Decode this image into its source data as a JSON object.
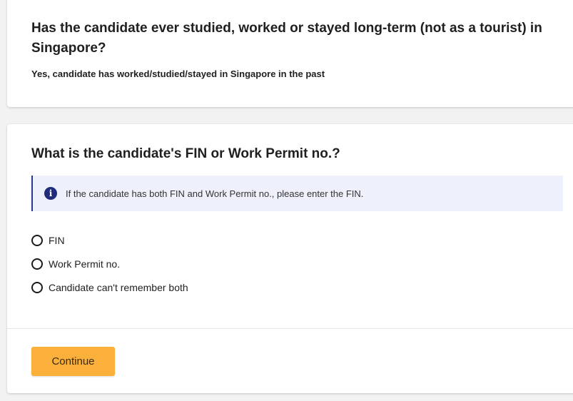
{
  "previous_question": {
    "title": "Has the candidate ever studied, worked or stayed long-term (not as a tourist) in Singapore?",
    "answer": "Yes, candidate has worked/studied/stayed in Singapore in the past"
  },
  "current_question": {
    "title": "What is the candidate's FIN or Work Permit no.?",
    "info": {
      "icon": "info-icon",
      "text": "If the candidate has both FIN and Work Permit no., please enter the FIN."
    },
    "options": [
      {
        "label": "FIN",
        "selected": false
      },
      {
        "label": "Work Permit no.",
        "selected": false
      },
      {
        "label": "Candidate can't remember both",
        "selected": false
      }
    ]
  },
  "footer": {
    "continue_label": "Continue"
  },
  "colors": {
    "accent_button": "#fbb03b",
    "info_background": "#eef1fb",
    "info_icon": "#1f2d7a"
  }
}
